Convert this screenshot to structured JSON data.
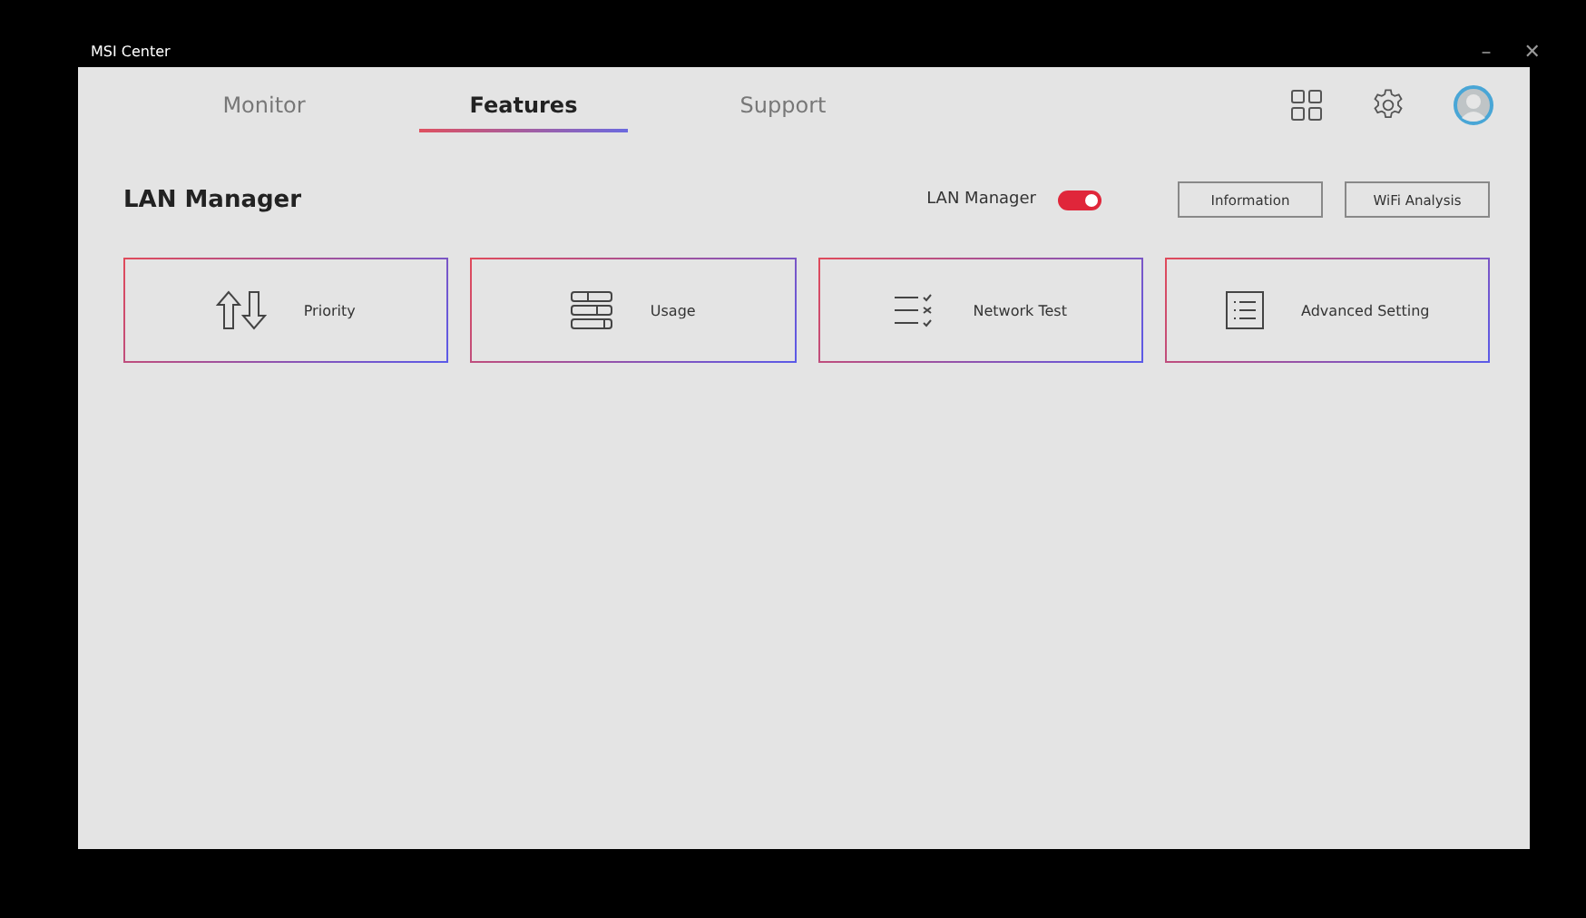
{
  "window": {
    "title": "MSI Center",
    "minimize": "–",
    "close": "✕"
  },
  "tabs": [
    {
      "label": "Monitor",
      "selected": false
    },
    {
      "label": "Features",
      "selected": true
    },
    {
      "label": "Support",
      "selected": false
    }
  ],
  "page": {
    "title": "LAN Manager",
    "toggle": {
      "label": "LAN Manager",
      "on": true
    },
    "buttons": [
      "Information",
      "WiFi Analysis"
    ]
  },
  "tiles": [
    {
      "kind": "priority",
      "label": "Priority"
    },
    {
      "kind": "usage",
      "label": "Usage"
    },
    {
      "kind": "test",
      "label": "Network Test"
    },
    {
      "kind": "settings",
      "label": "Advanced Setting"
    }
  ]
}
